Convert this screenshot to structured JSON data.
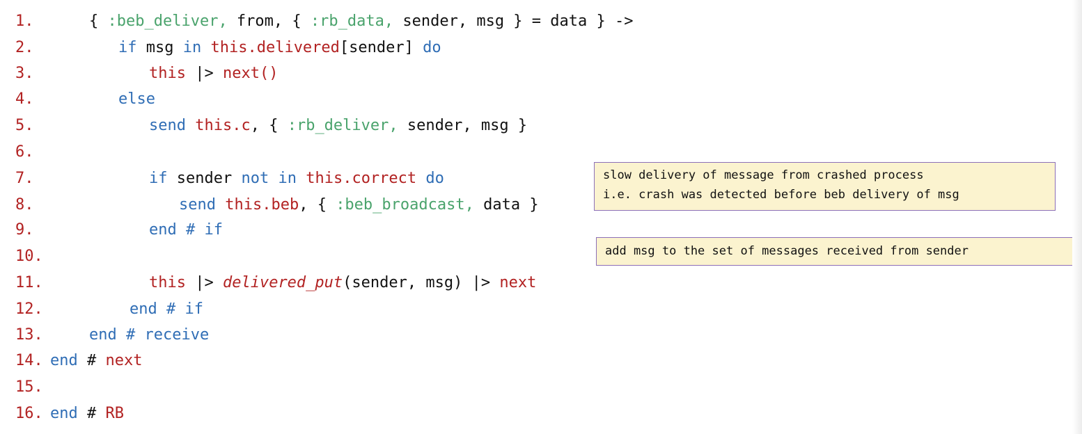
{
  "lines": [
    {
      "num": "1.",
      "tokens": [
        {
          "t": "{ ",
          "c": "plain"
        },
        {
          "t": ":beb_deliver,",
          "c": "at"
        },
        {
          "t": " from, { ",
          "c": "plain"
        },
        {
          "t": ":rb_data,",
          "c": "at"
        },
        {
          "t": " sender, msg } = data } ->",
          "c": "plain"
        }
      ]
    },
    {
      "num": "2.",
      "tokens": [
        {
          "t": "if",
          "c": "kw"
        },
        {
          "t": " msg ",
          "c": "plain"
        },
        {
          "t": "in",
          "c": "kw"
        },
        {
          "t": " ",
          "c": "plain"
        },
        {
          "t": "this.delivered",
          "c": "rd"
        },
        {
          "t": "[sender] ",
          "c": "plain"
        },
        {
          "t": "do",
          "c": "kw"
        }
      ]
    },
    {
      "num": "3.",
      "tokens": [
        {
          "t": "this",
          "c": "rd"
        },
        {
          "t": " |> ",
          "c": "plain"
        },
        {
          "t": "next()",
          "c": "rd"
        }
      ]
    },
    {
      "num": "4.",
      "tokens": [
        {
          "t": "else",
          "c": "kw"
        }
      ]
    },
    {
      "num": "5.",
      "tokens": [
        {
          "t": "send",
          "c": "kw"
        },
        {
          "t": " ",
          "c": "plain"
        },
        {
          "t": "this.c",
          "c": "rd"
        },
        {
          "t": ", { ",
          "c": "plain"
        },
        {
          "t": ":rb_deliver,",
          "c": "at"
        },
        {
          "t": " sender, msg }",
          "c": "plain"
        }
      ]
    },
    {
      "num": "6.",
      "tokens": []
    },
    {
      "num": "7.",
      "tokens": [
        {
          "t": "if",
          "c": "kw"
        },
        {
          "t": " sender ",
          "c": "plain"
        },
        {
          "t": "not",
          "c": "kw"
        },
        {
          "t": " ",
          "c": "plain"
        },
        {
          "t": "in",
          "c": "kw"
        },
        {
          "t": " ",
          "c": "plain"
        },
        {
          "t": "this.correct",
          "c": "rd"
        },
        {
          "t": " ",
          "c": "plain"
        },
        {
          "t": "do",
          "c": "kw"
        }
      ]
    },
    {
      "num": "8.",
      "tokens": [
        {
          "t": "send",
          "c": "kw"
        },
        {
          "t": " ",
          "c": "plain"
        },
        {
          "t": "this.beb",
          "c": "rd"
        },
        {
          "t": ", { ",
          "c": "plain"
        },
        {
          "t": ":beb_broadcast,",
          "c": "at"
        },
        {
          "t": " data }",
          "c": "plain"
        }
      ]
    },
    {
      "num": "9.",
      "tokens": [
        {
          "t": "end # if",
          "c": "kw"
        }
      ]
    },
    {
      "num": "10.",
      "tokens": []
    },
    {
      "num": "11.",
      "tokens": [
        {
          "t": "this",
          "c": "rd"
        },
        {
          "t": " |> ",
          "c": "plain"
        },
        {
          "t": "delivered_put",
          "c": "it"
        },
        {
          "t": "(sender, msg) |> ",
          "c": "plain"
        },
        {
          "t": "next",
          "c": "rd"
        }
      ]
    },
    {
      "num": "12.",
      "tokens": [
        {
          "t": "end # if",
          "c": "kw"
        }
      ]
    },
    {
      "num": "13.",
      "tokens": [
        {
          "t": "end # receive",
          "c": "kw"
        }
      ]
    },
    {
      "num": "14.",
      "tokens": [
        {
          "t": "end",
          "c": "kw"
        },
        {
          "t": " # ",
          "c": "plain"
        },
        {
          "t": "next",
          "c": "rd"
        }
      ]
    },
    {
      "num": "15.",
      "tokens": []
    },
    {
      "num": "16.",
      "tokens": [
        {
          "t": "end",
          "c": "kw"
        },
        {
          "t": " # ",
          "c": "plain"
        },
        {
          "t": "RB",
          "c": "rd"
        }
      ]
    }
  ],
  "notes": {
    "slow_delivery": "slow delivery of message from crashed process\ni.e. crash was detected before beb delivery of msg",
    "add_msg": "add msg to the set of messages received from sender"
  },
  "colors": {
    "keyword": "#2f6db5",
    "identifier": "#b22222",
    "atom": "#4aa36c",
    "text": "#111111",
    "note_background": "#fbf3cf",
    "note_border": "#8c6fb8"
  }
}
